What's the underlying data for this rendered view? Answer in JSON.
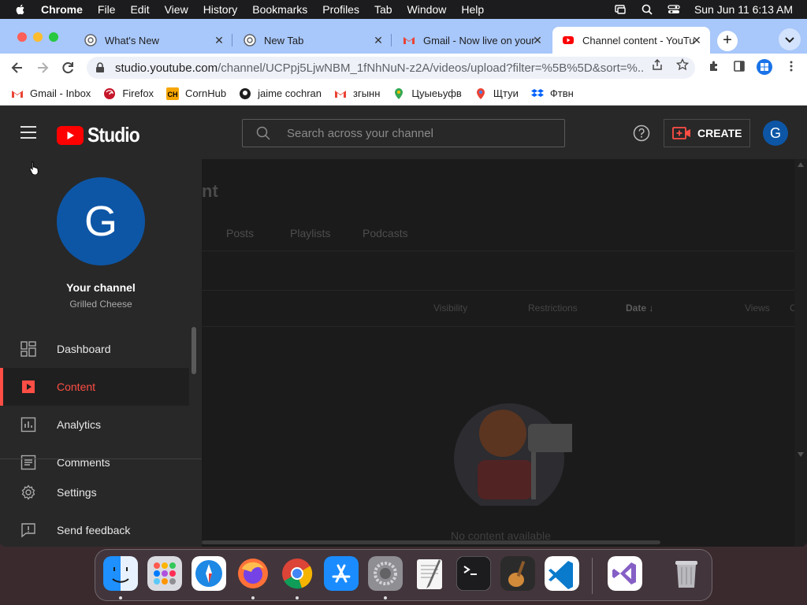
{
  "menubar": {
    "app_name": "Chrome",
    "items": [
      "File",
      "Edit",
      "View",
      "History",
      "Bookmarks",
      "Profiles",
      "Tab",
      "Window",
      "Help"
    ],
    "clock": "Sun Jun 11  6:13 AM"
  },
  "tabs": [
    {
      "title": "What's New",
      "icon": "chrome-icon"
    },
    {
      "title": "New Tab",
      "icon": "chrome-icon"
    },
    {
      "title": "Gmail - Now live on your",
      "icon": "gmail-icon"
    },
    {
      "title": "Channel content - YouTu",
      "icon": "youtube-icon",
      "active": true
    }
  ],
  "toolbar": {
    "url_host": "studio.youtube.com",
    "url_path": "/channel/UCPpj5LjwNBM_1fNhNuN-z2A/videos/upload?filter=%5B%5D&sort=%..."
  },
  "bookmarks": [
    {
      "label": "Gmail - Inbox",
      "icon": "gmail-icon"
    },
    {
      "label": "Firefox",
      "icon": "firefox-icon"
    },
    {
      "label": "CornHub",
      "icon": "ch-icon"
    },
    {
      "label": "jaime cochran",
      "icon": "github-icon"
    },
    {
      "label": "згынн",
      "icon": "gmail-icon"
    },
    {
      "label": "Цуыеьуфв",
      "icon": "maps-pin-icon"
    },
    {
      "label": "Щтуи",
      "icon": "maps-pin-icon"
    },
    {
      "label": "Фтвн",
      "icon": "dropbox-icon"
    }
  ],
  "studio": {
    "logo_text": "Studio",
    "search_placeholder": "Search across your channel",
    "create_label": "CREATE",
    "avatar_letter": "G",
    "channel_title": "Your channel",
    "channel_name": "Grilled Cheese",
    "nav": [
      {
        "label": "Dashboard",
        "icon": "dashboard-icon"
      },
      {
        "label": "Content",
        "icon": "content-icon",
        "active": true
      },
      {
        "label": "Analytics",
        "icon": "analytics-icon"
      },
      {
        "label": "Comments",
        "icon": "comments-icon"
      },
      {
        "label": "Settings",
        "icon": "settings-icon"
      },
      {
        "label": "Send feedback",
        "icon": "feedback-icon"
      }
    ],
    "page_title_fragment": "nt",
    "subtabs": [
      "Posts",
      "Playlists",
      "Podcasts"
    ],
    "columns": [
      "Visibility",
      "Restrictions",
      "Date",
      "Views",
      "C"
    ],
    "empty_text": "No content available"
  },
  "colors": {
    "accent_red": "#ff4e45",
    "avatar_blue": "#0d56a6",
    "tabstrip": "#a8c7fa",
    "studio_bg": "#282828"
  }
}
